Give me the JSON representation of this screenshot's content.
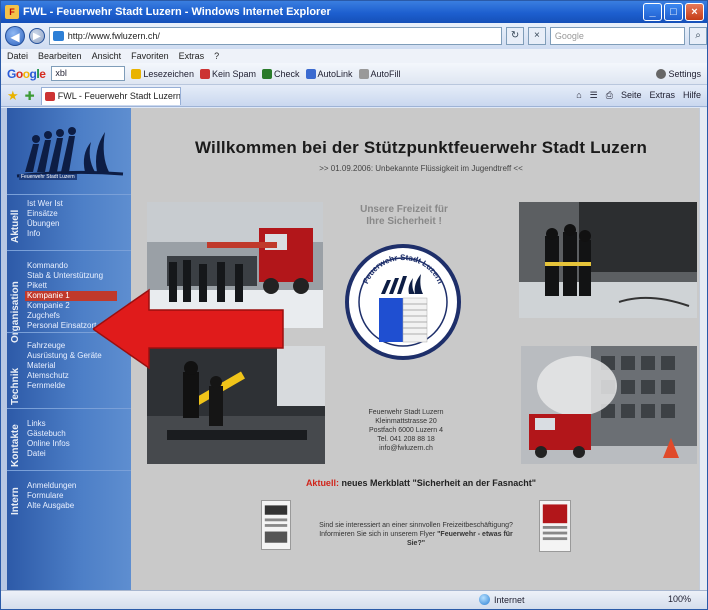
{
  "window": {
    "title": "FWL - Feuerwehr Stadt Luzern - Windows Internet Explorer",
    "controls": {
      "minimize": "_",
      "maximize": "□",
      "close": "×"
    }
  },
  "addressbar": {
    "url": "http://www.fwluzern.ch/",
    "search_placeholder": "Google"
  },
  "menu": [
    "Datei",
    "Bearbeiten",
    "Ansicht",
    "Favoriten",
    "Extras",
    "?"
  ],
  "google_toolbar": {
    "logo": "Google",
    "search_value": "xbl",
    "items": [
      "Lesezeichen",
      "Kein Spam",
      "Check",
      "AutoLink",
      "AutoFill"
    ],
    "settings": "Settings"
  },
  "tabs": {
    "active": "FWL - Feuerwehr Stadt Luzern",
    "commands": [
      "Seite",
      "Extras",
      "Hilfe"
    ]
  },
  "sidebar": {
    "logo_sub": "Feuerwehr Stadt Luzern",
    "sections": [
      {
        "label": "Aktuell",
        "items": [
          "Ist Wer Ist",
          "Einsätze",
          "Übungen",
          "Info"
        ]
      },
      {
        "label": "Organisation",
        "items": [
          "Kommando",
          "Stab & Unterstützung",
          "Pikett",
          "Kompanie 1",
          "Kompanie 2",
          "Zugchefs",
          "Personal Einsatzort"
        ]
      },
      {
        "label": "Technik",
        "items": [
          "Fahrzeuge",
          "Ausrüstung & Geräte",
          "Material",
          "Atemschutz",
          "Fernmelde"
        ]
      },
      {
        "label": "Kontakte",
        "items": [
          "Links",
          "Gästebuch",
          "Online Infos",
          "Datei"
        ]
      },
      {
        "label": "Intern",
        "items": [
          "Anmeldungen",
          "Formulare",
          "Alte Ausgabe"
        ]
      }
    ],
    "active_item": "Kompanie 1"
  },
  "main": {
    "headline": "Willkommen bei der Stützpunktfeuerwehr Stadt Luzern",
    "tagline": ">> 01.09.2006: Unbekannte Flüssigkeit im Jugendtreff <<",
    "freizeit": [
      "Unsere Freizeit für",
      "Ihre Sicherheit !"
    ],
    "emblem_text": "Feuerwehr Stadt Luzern",
    "address": [
      "Feuerwehr Stadt Luzern",
      "Kleinmattstrasse 20",
      "Postfach 6000 Luzern 4",
      "Tel. 041 208 88 18",
      "info@fwluzern.ch"
    ],
    "aktuell_label": "Aktuell:",
    "aktuell_text": "neues Merkblatt \"Sicherheit an der Fasnacht\"",
    "flyer_text_1": "Sind sie interessiert an einer sinnvollen Freizeitbeschäftigung? Informieren Sie sich in",
    "flyer_text_2": "unserem Flyer ",
    "flyer_text_bold": "\"Feuerwehr - etwas für Sie?\""
  },
  "statusbar": {
    "zone": "Internet",
    "zoom": "100%"
  },
  "colors": {
    "sidebar": "#3d6bb8",
    "accent_red": "#d0241a",
    "arrow": "#e01b1b"
  }
}
